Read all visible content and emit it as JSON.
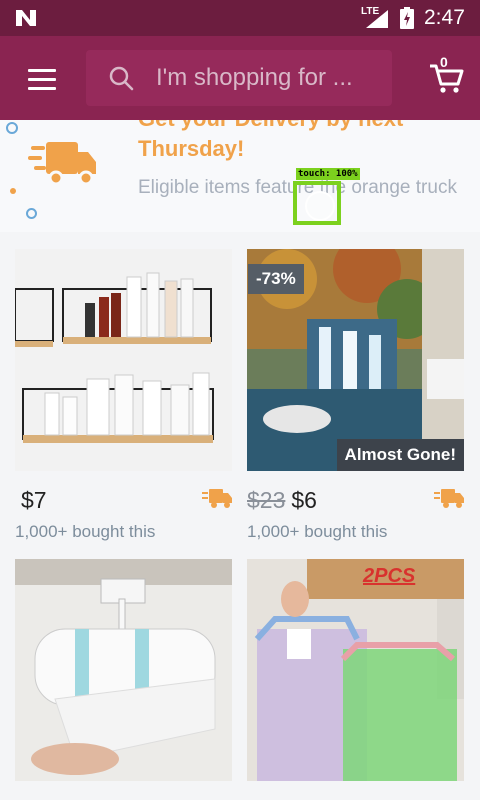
{
  "status_bar": {
    "network": "LTE",
    "time": "2:47"
  },
  "header": {
    "search": {
      "placeholder": "I'm shopping for ..."
    },
    "cart_count": "0"
  },
  "banner": {
    "headline": "Get your Delivery by next Thursday!",
    "subtext": "Eligible items feature the orange truck"
  },
  "touch_indicator": {
    "label": "touch: 100%"
  },
  "products": [
    {
      "price": "$7",
      "old_price": "",
      "bought": "1,000+ bought this",
      "badge": "",
      "status": ""
    },
    {
      "price": "$6",
      "old_price": "$23",
      "bought": "1,000+ bought this",
      "badge": "-73%",
      "status": "Almost Gone!"
    },
    {
      "price": "",
      "old_price": "",
      "bought": "",
      "badge": "",
      "status": "",
      "image_text": "2PCS"
    },
    {
      "price": "",
      "old_price": "",
      "bought": "",
      "badge": "",
      "status": ""
    }
  ],
  "colors": {
    "status_bar": "#6c1d3f",
    "app_bar": "#8a2451",
    "accent_orange": "#f0a24a"
  }
}
